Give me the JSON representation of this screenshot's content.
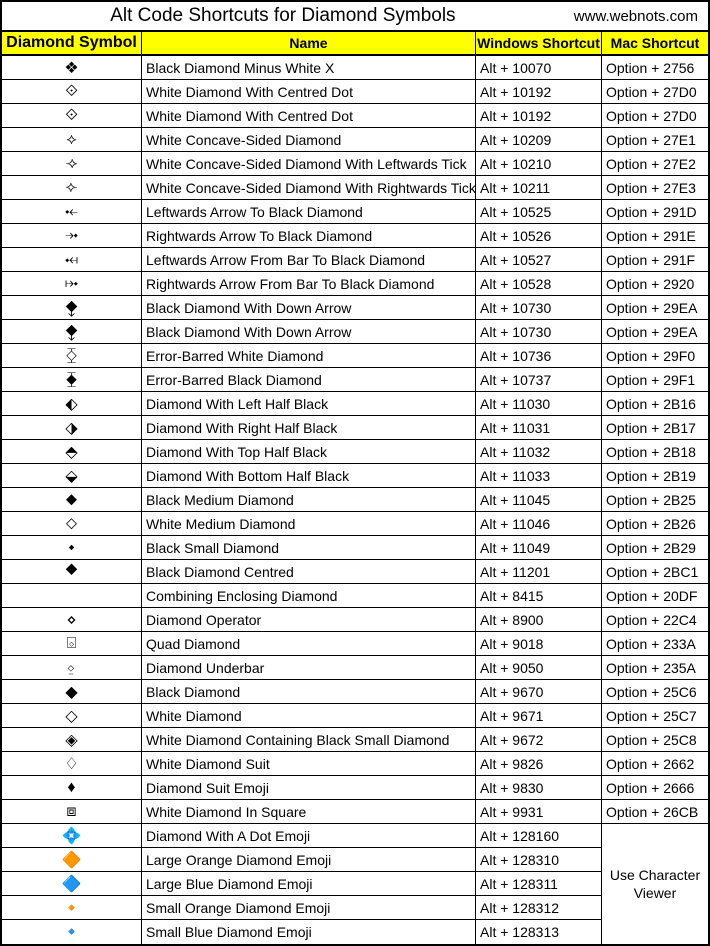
{
  "title": "Alt Code Shortcuts for Diamond Symbols",
  "site": "www.webnots.com",
  "headers": {
    "symbol": "Diamond Symbol",
    "name": "Name",
    "windows": "Windows Shortcut",
    "mac": "Mac Shortcut"
  },
  "rows": [
    {
      "sym": "❖",
      "name": "Black Diamond Minus White X",
      "win": "Alt + 10070",
      "mac": "Option + 2756"
    },
    {
      "sym": "⟐",
      "name": "White Diamond With Centred Dot",
      "win": "Alt + 10192",
      "mac": "Option + 27D0"
    },
    {
      "sym": "⟐",
      "name": "White Diamond With Centred Dot",
      "win": "Alt + 10192",
      "mac": "Option + 27D0"
    },
    {
      "sym": "⟡",
      "name": "White Concave-Sided Diamond",
      "win": "Alt + 10209",
      "mac": "Option + 27E1"
    },
    {
      "sym": "⟢",
      "name": "White Concave-Sided Diamond With Leftwards Tick",
      "win": "Alt + 10210",
      "mac": "Option + 27E2"
    },
    {
      "sym": "⟣",
      "name": "White Concave-Sided Diamond With Rightwards Tick",
      "win": "Alt + 10211",
      "mac": "Option + 27E3"
    },
    {
      "sym": "⤝",
      "name": "Leftwards Arrow To Black Diamond",
      "win": "Alt + 10525",
      "mac": "Option + 291D"
    },
    {
      "sym": "⤞",
      "name": "Rightwards Arrow To Black Diamond",
      "win": "Alt + 10526",
      "mac": "Option + 291E"
    },
    {
      "sym": "⤟",
      "name": "Leftwards Arrow From Bar To Black Diamond",
      "win": "Alt + 10527",
      "mac": "Option + 291F"
    },
    {
      "sym": "⤠",
      "name": "Rightwards Arrow From Bar To Black Diamond",
      "win": "Alt + 10528",
      "mac": "Option + 2920"
    },
    {
      "sym": "⧪",
      "name": "Black Diamond With Down Arrow",
      "win": "Alt + 10730",
      "mac": "Option + 29EA"
    },
    {
      "sym": "⧪",
      "name": "Black Diamond With Down Arrow",
      "win": "Alt + 10730",
      "mac": "Option + 29EA"
    },
    {
      "sym": "⧰",
      "name": "Error-Barred White Diamond",
      "win": "Alt + 10736",
      "mac": "Option + 29F0"
    },
    {
      "sym": "⧱",
      "name": "Error-Barred Black Diamond",
      "win": "Alt + 10737",
      "mac": "Option + 29F1"
    },
    {
      "sym": "⬖",
      "name": "Diamond With Left Half Black",
      "win": "Alt + 11030",
      "mac": "Option + 2B16"
    },
    {
      "sym": "⬗",
      "name": "Diamond With Right Half Black",
      "win": "Alt + 11031",
      "mac": "Option + 2B17"
    },
    {
      "sym": "⬘",
      "name": "Diamond With Top Half Black",
      "win": "Alt + 11032",
      "mac": "Option + 2B18"
    },
    {
      "sym": "⬙",
      "name": "Diamond With Bottom Half Black",
      "win": "Alt + 11033",
      "mac": "Option + 2B19"
    },
    {
      "sym": "⬥",
      "name": "Black Medium Diamond",
      "win": "Alt + 11045",
      "mac": "Option + 2B25"
    },
    {
      "sym": "⬦",
      "name": "White Medium Diamond",
      "win": "Alt + 11046",
      "mac": "Option + 2B26"
    },
    {
      "sym": "⬩",
      "name": "Black Small Diamond",
      "win": "Alt + 11049",
      "mac": "Option + 2B29"
    },
    {
      "sym": "⯁",
      "name": "Black Diamond Centred",
      "win": "Alt + 11201",
      "mac": "Option + 2BC1"
    },
    {
      "sym": "",
      "name": "Combining Enclosing Diamond",
      "win": "Alt + 8415",
      "mac": "Option + 20DF"
    },
    {
      "sym": "⋄",
      "name": "Diamond Operator",
      "win": "Alt + 8900",
      "mac": "Option + 22C4"
    },
    {
      "sym": "⌺",
      "name": "Quad Diamond",
      "win": "Alt + 9018",
      "mac": "Option + 233A"
    },
    {
      "sym": "⍚",
      "name": "Diamond Underbar",
      "win": "Alt + 9050",
      "mac": "Option + 235A"
    },
    {
      "sym": "◆",
      "name": "Black Diamond",
      "win": "Alt + 9670",
      "mac": "Option + 25C6"
    },
    {
      "sym": "◇",
      "name": "White Diamond",
      "win": "Alt + 9671",
      "mac": "Option + 25C7"
    },
    {
      "sym": "◈",
      "name": "White Diamond Containing Black Small Diamond",
      "win": "Alt + 9672",
      "mac": "Option + 25C8"
    },
    {
      "sym": "♢",
      "name": "White Diamond Suit",
      "win": "Alt + 9826",
      "mac": "Option + 2662"
    },
    {
      "sym": "♦",
      "name": "Diamond Suit Emoji",
      "win": "Alt + 9830",
      "mac": "Option + 2666"
    },
    {
      "sym": "⧈",
      "name": "White Diamond In Square",
      "win": "Alt + 9931",
      "mac": "Option + 26CB"
    }
  ],
  "merged_rows": [
    {
      "sym": "💠",
      "name": "Diamond With A Dot Emoji",
      "win": "Alt + 128160"
    },
    {
      "sym": "🔶",
      "name": "Large Orange Diamond Emoji",
      "win": "Alt + 128310"
    },
    {
      "sym": "🔷",
      "name": "Large Blue Diamond Emoji",
      "win": "Alt + 128311"
    },
    {
      "sym": "🔸",
      "name": "Small Orange Diamond Emoji",
      "win": "Alt + 128312"
    },
    {
      "sym": "🔹",
      "name": "Small Blue Diamond Emoji",
      "win": "Alt + 128313"
    }
  ],
  "merged_mac_note": "Use Character Viewer"
}
